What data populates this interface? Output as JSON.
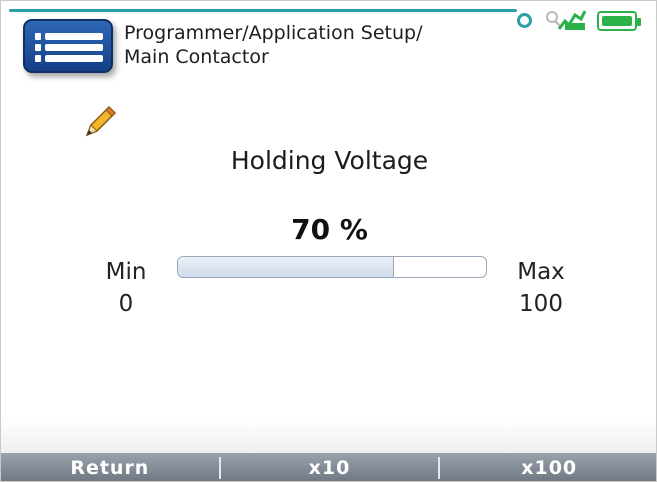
{
  "header": {
    "title_line1": "Programmer/Application Setup/",
    "title_line2": "Main Contactor",
    "icons": {
      "menu": "menu-icon",
      "link": "link-status-icon",
      "signal": "signal-icon",
      "battery": "battery-icon",
      "edit": "pencil-icon"
    },
    "colors": {
      "menu_button": "#1f53a3",
      "accent": "#2f9da8",
      "battery": "#2bb34a"
    }
  },
  "parameter": {
    "name": "Holding Voltage",
    "value_text": "70 %",
    "value": 70,
    "min_label": "Min",
    "min_value": "0",
    "max_label": "Max",
    "max_value": "100",
    "fill_fraction": 0.7
  },
  "softkeys": [
    "Return",
    "x10",
    "x100"
  ]
}
